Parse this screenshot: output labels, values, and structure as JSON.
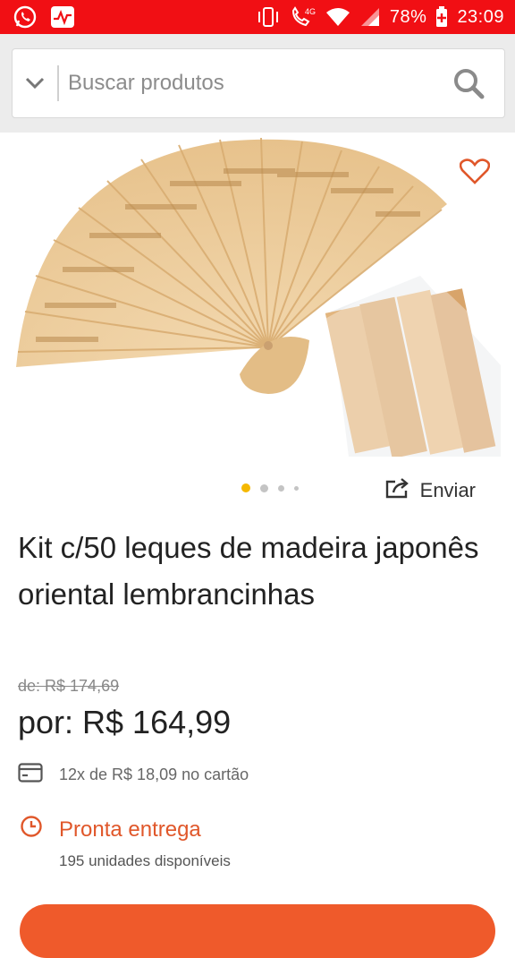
{
  "status_bar": {
    "battery": "78%",
    "time": "23:09",
    "network": "4G"
  },
  "search": {
    "placeholder": "Buscar produtos"
  },
  "carousel": {
    "share_label": "Enviar"
  },
  "product": {
    "title": "Kit c/50 leques de madeira japonês oriental lembrancinhas",
    "old_price": "de: R$ 174,69",
    "price": "por: R$ 164,99",
    "installments": "12x de R$ 18,09 no cartão",
    "stock_status": "Pronta entrega",
    "units_available": "195 unidades disponíveis"
  },
  "colors": {
    "status_bar": "#f10f14",
    "accent_orange": "#e0572a",
    "dot_active": "#f5b800"
  }
}
